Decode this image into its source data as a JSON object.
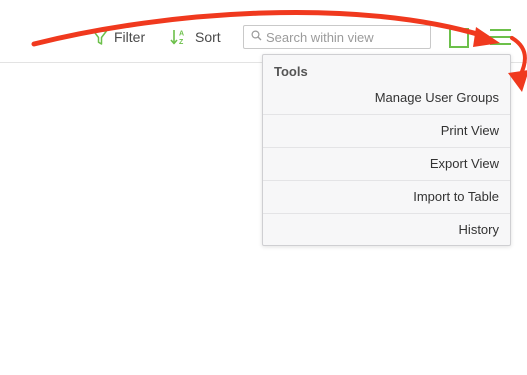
{
  "toolbar": {
    "filter_label": "Filter",
    "sort_label": "Sort",
    "search_placeholder": "Search within view",
    "icons": {
      "filter": "filter-icon",
      "sort": "sort-az-icon",
      "search": "search-icon",
      "window": "window-icon",
      "menu": "hamburger-menu-icon"
    }
  },
  "menu": {
    "heading": "Tools",
    "items": [
      {
        "label": "Manage User Groups"
      },
      {
        "label": "Print View"
      },
      {
        "label": "Export View"
      },
      {
        "label": "Import to Table"
      },
      {
        "label": "History"
      }
    ]
  },
  "colors": {
    "accent_green": "#6cc04a",
    "annotation_red": "#f0391e"
  }
}
